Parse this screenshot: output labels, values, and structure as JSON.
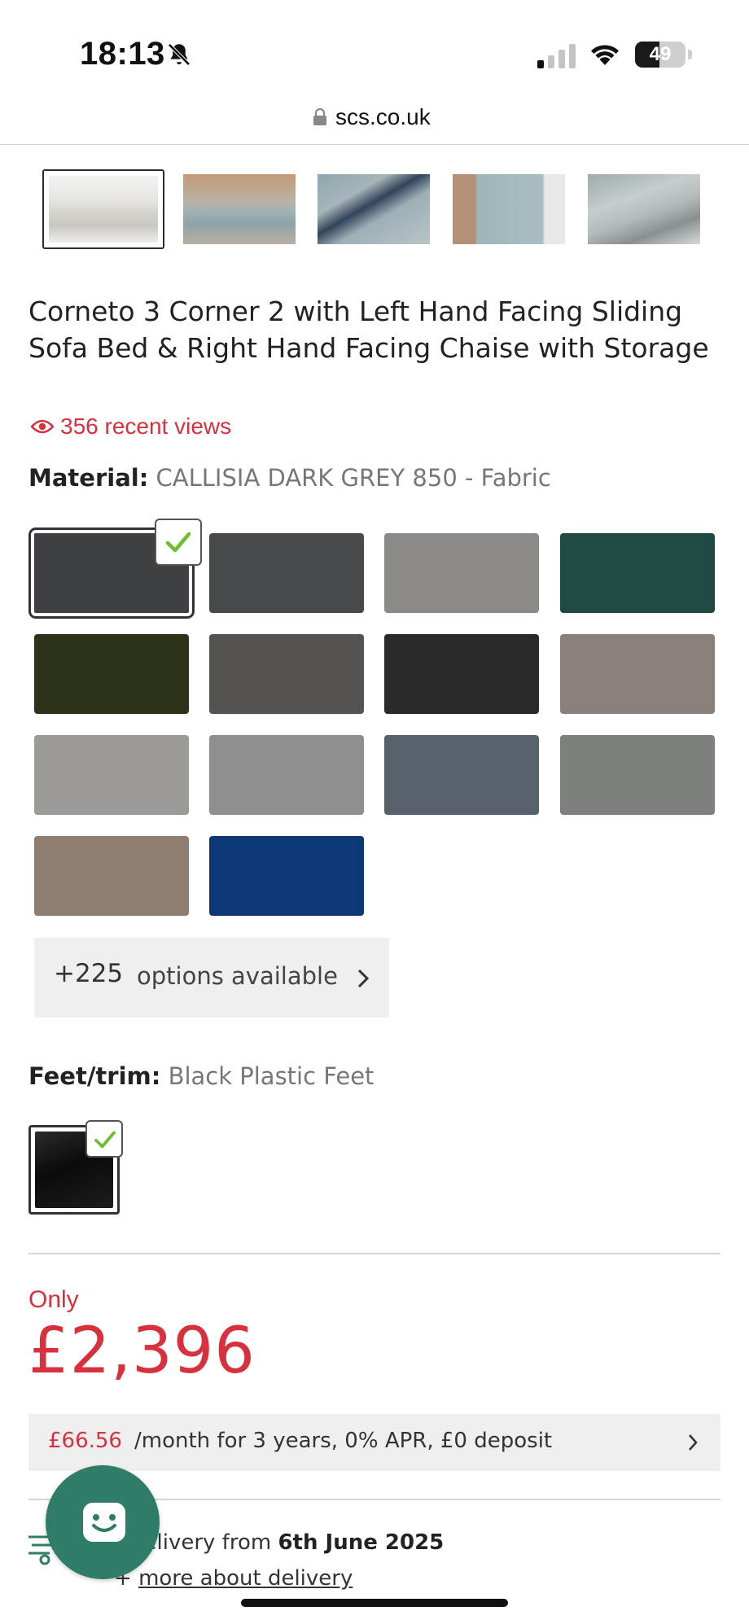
{
  "status_bar": {
    "time": "18:13",
    "battery_level": "49",
    "battery_fraction": 0.49,
    "icons": [
      "bell-slash-icon",
      "signal-icon",
      "wifi-icon",
      "battery-icon"
    ]
  },
  "browser": {
    "url": "scs.co.uk",
    "lock_icon": "lock-icon"
  },
  "gallery": {
    "thumbnails": [
      {
        "alt": "sofa-front",
        "selected": true
      },
      {
        "alt": "sofa-room",
        "selected": false
      },
      {
        "alt": "sofa-corner-cushions",
        "selected": false
      },
      {
        "alt": "sofa-arm-detail",
        "selected": false
      },
      {
        "alt": "sofa-chaise-detail",
        "selected": false
      }
    ]
  },
  "product": {
    "title": "Corneto 3 Corner 2 with Left Hand Facing Sliding Sofa Bed & Right Hand Facing Chaise with Storage",
    "views": "356 recent views",
    "material_label": "Material:",
    "material_value": "CALLISIA DARK GREY 850 - Fabric",
    "swatches": [
      {
        "color": "#3f4044",
        "selected": true
      },
      {
        "color": "#47494b",
        "selected": false
      },
      {
        "color": "#8c8a87",
        "selected": false
      },
      {
        "color": "#1f4a44",
        "selected": false
      },
      {
        "color": "#2c3318",
        "selected": false
      },
      {
        "color": "#55524f",
        "selected": false
      },
      {
        "color": "#2a2a2a",
        "selected": false
      },
      {
        "color": "#8a807b",
        "selected": false
      },
      {
        "color": "#9c9a97",
        "selected": false
      },
      {
        "color": "#8f8f8f",
        "selected": false
      },
      {
        "color": "#56616c",
        "selected": false
      },
      {
        "color": "#7e807e",
        "selected": false
      },
      {
        "color": "#8e7e72",
        "selected": false
      },
      {
        "color": "#0d3877",
        "selected": false
      }
    ],
    "more_options": {
      "count": "+225",
      "label": "options available"
    },
    "feet_label": "Feet/trim:",
    "feet_value": "Black Plastic Feet",
    "price_prefix": "Only",
    "price": "£2,396",
    "finance": {
      "amount": "£66.56",
      "text": "/month for 3 years, 0% APR, £0 deposit"
    },
    "delivery": {
      "prefix": "delivery from",
      "date": "6th June 2025",
      "more_prefix": "+",
      "more_link": "more about delivery"
    }
  },
  "colors": {
    "accent_red": "#d9303e",
    "chat_green": "#2f7c68",
    "check_green": "#6cbf2a"
  }
}
